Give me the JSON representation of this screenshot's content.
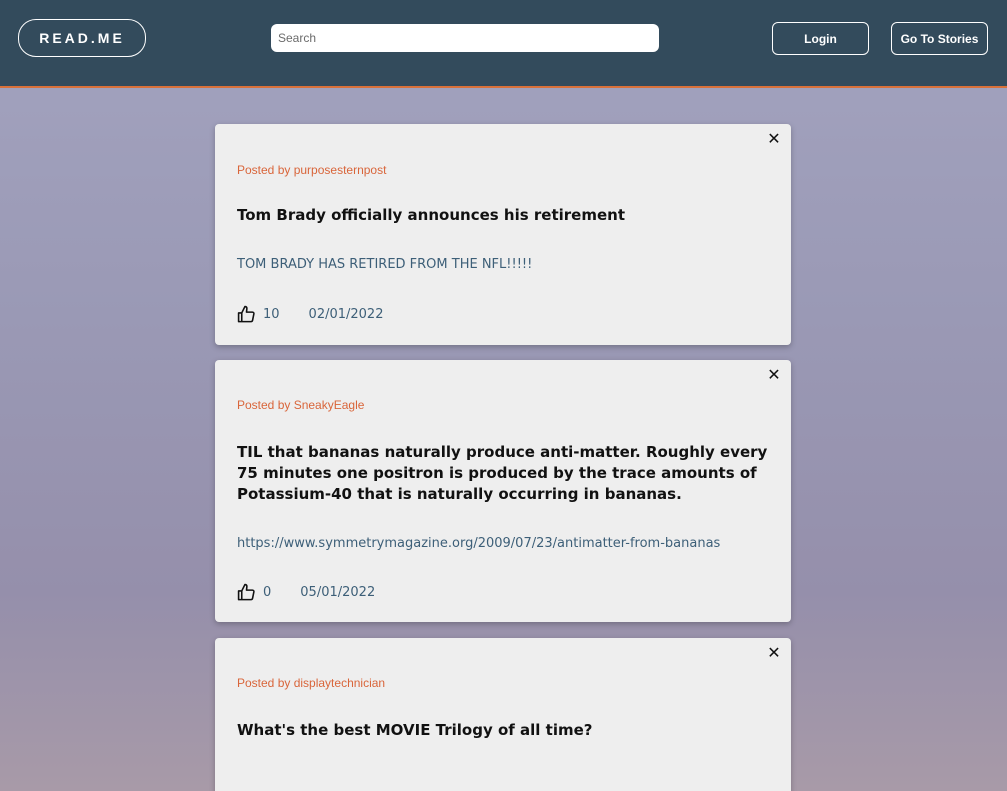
{
  "header": {
    "logo": "READ.ME",
    "search_placeholder": "Search",
    "login_label": "Login",
    "stories_label": "Go To Stories"
  },
  "icons": {
    "close": "close-icon",
    "like": "thumbs-up-icon"
  },
  "colors": {
    "navbar": "#334b5c",
    "accent": "#d9713a",
    "card": "#eeeeee",
    "link": "#3d5f78"
  },
  "posts": [
    {
      "posted_by": "Posted by purposesternpost",
      "title": "Tom Brady officially announces his retirement",
      "body": "TOM BRADY HAS RETIRED FROM THE NFL!!!!!",
      "likes": "10",
      "date": "02/01/2022"
    },
    {
      "posted_by": "Posted by SneakyEagle",
      "title": "TIL that bananas naturally produce anti-matter. Roughly every 75 minutes one positron is produced by the trace amounts of Potassium-40 that is naturally occurring in bananas.",
      "body": "https://www.symmetrymagazine.org/2009/07/23/antimatter-from-bananas",
      "likes": "0",
      "date": "05/01/2022"
    },
    {
      "posted_by": "Posted by displaytechnician",
      "title": "What's the best MOVIE Trilogy of all time?"
    }
  ]
}
